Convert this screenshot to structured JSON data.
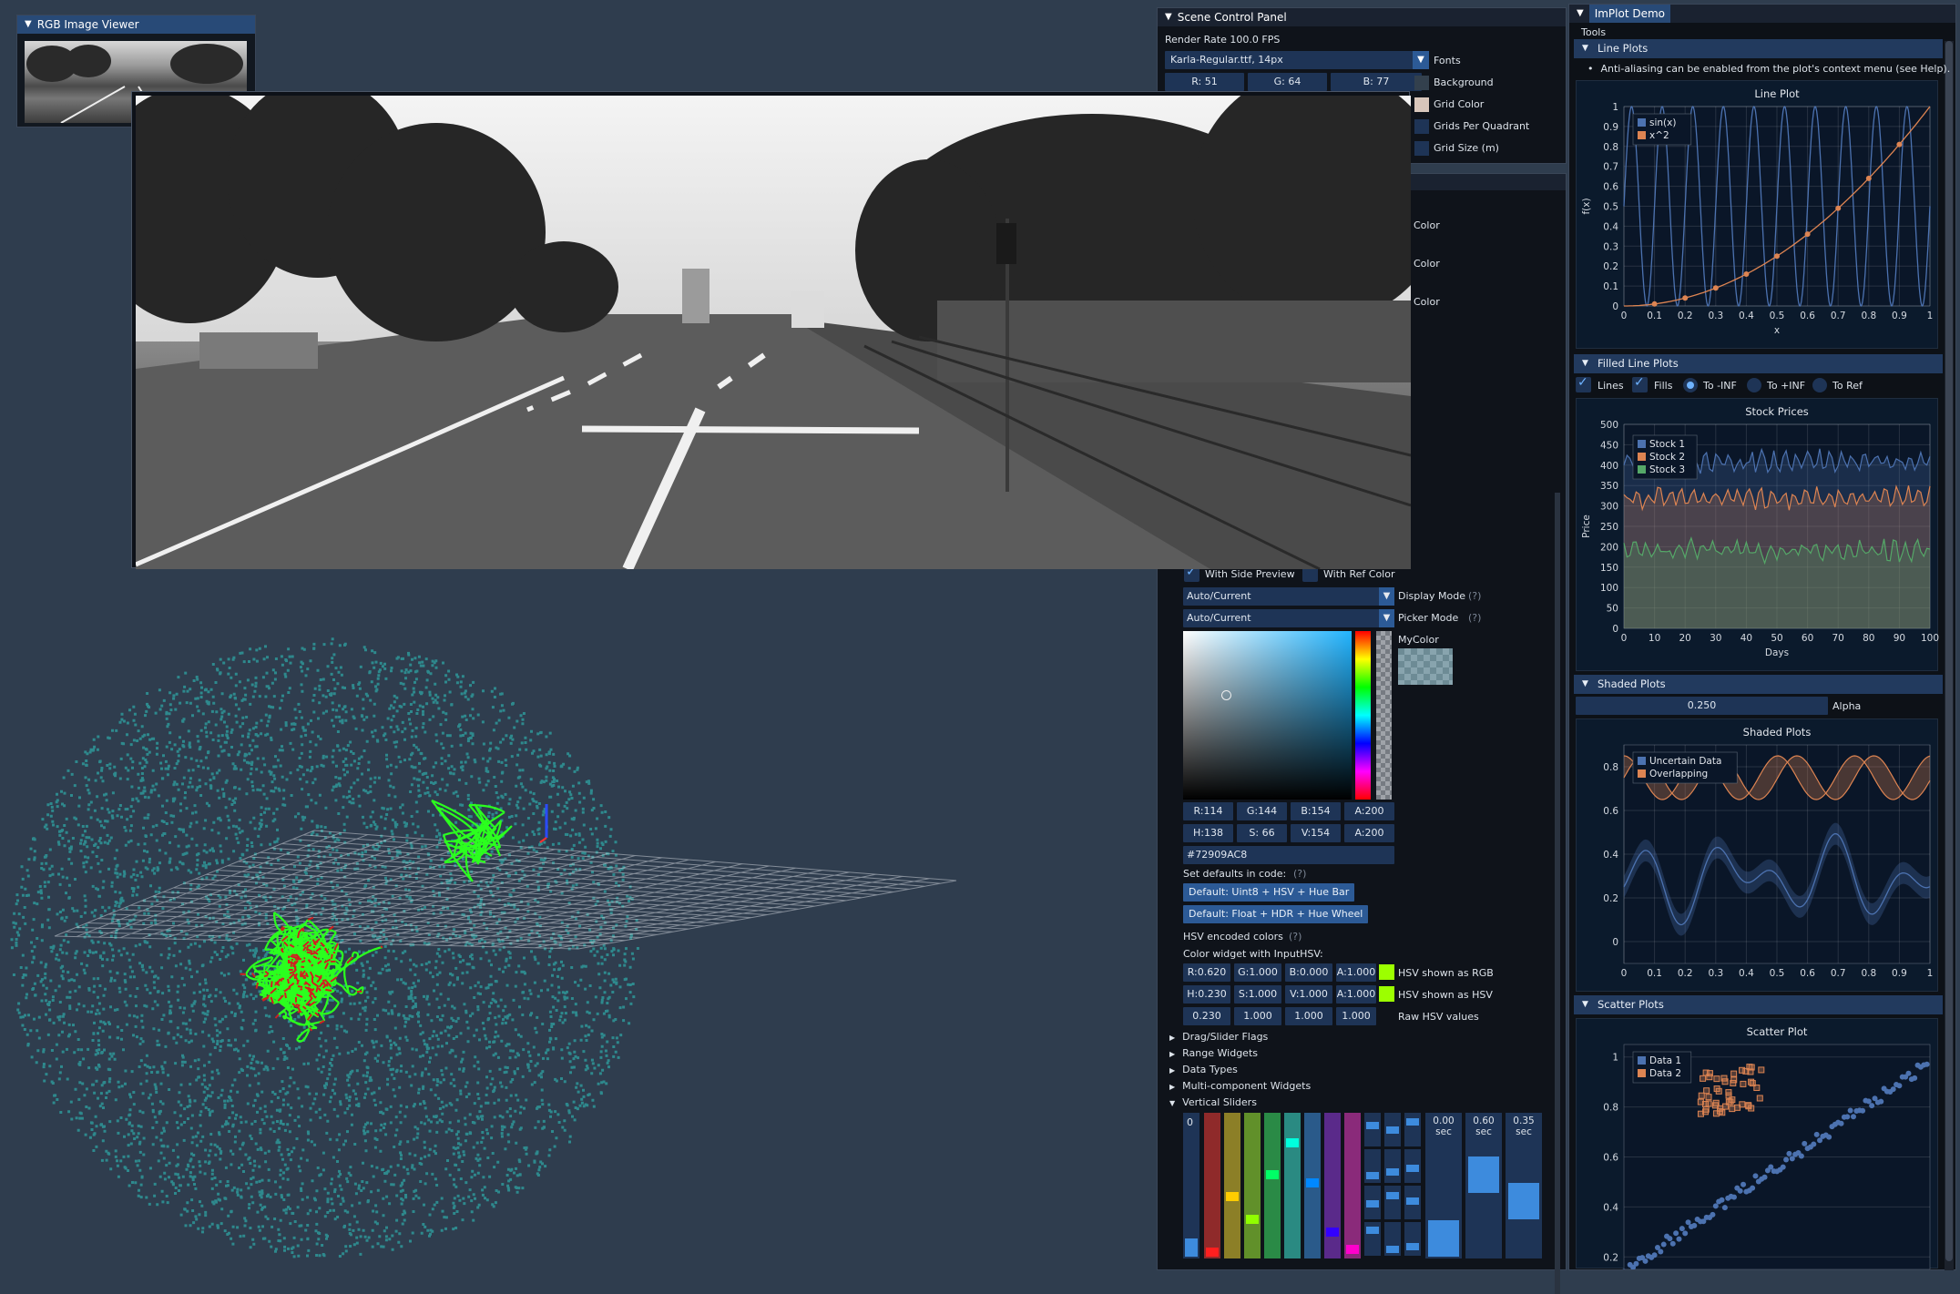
{
  "rgb_viewer": {
    "title": "RGB Image Viewer"
  },
  "scene_panel": {
    "title": "Scene Control Panel",
    "render_rate": "Render Rate 100.0 FPS",
    "font_select": "Karla-Regular.ttf, 14px",
    "fonts_label": "Fonts",
    "bg": {
      "r": "R: 51",
      "g": "G: 64",
      "b": "B: 77"
    },
    "background_label": "Background",
    "grid_color_label": "Grid Color",
    "grids_per_quadrant_label": "Grids Per Quadrant",
    "grid_size_label": "Grid Size (m)",
    "color_labels": [
      "Color",
      "Color",
      "Color"
    ]
  },
  "color_widgets": {
    "side_preview": "With Side Preview",
    "ref_color": "With Ref Color",
    "display_mode_value": "Auto/Current",
    "display_mode_label": "Display Mode",
    "picker_mode_value": "Auto/Current",
    "picker_mode_label": "Picker Mode",
    "help": "(?)",
    "mycolor_label": "MyColor",
    "rgba": {
      "r": "R:114",
      "g": "G:144",
      "b": "B:154",
      "a": "A:200"
    },
    "hsva": {
      "h": "H:138",
      "s": "S: 66",
      "v": "V:154",
      "a": "A:200"
    },
    "hex": "#72909AC8",
    "defaults_label": "Set defaults in code:",
    "default1": "Default: Uint8 + HSV + Hue Bar",
    "default2": "Default: Float + HDR + Hue Wheel",
    "hsv_encoded": "HSV encoded colors",
    "inputhsv": "Color widget with InputHSV:",
    "row1": {
      "a": "R:0.620",
      "b": "G:1.000",
      "c": "B:0.000",
      "d": "A:1.000",
      "label": "HSV shown as RGB"
    },
    "row2": {
      "a": "H:0.230",
      "b": "S:1.000",
      "c": "V:1.000",
      "d": "A:1.000",
      "label": "HSV shown as HSV"
    },
    "row3": {
      "a": "0.230",
      "b": "1.000",
      "c": "1.000",
      "d": "1.000",
      "label": "Raw HSV values"
    },
    "tree": [
      "Drag/Slider Flags",
      "Range Widgets",
      "Data Types",
      "Multi-component Widgets",
      "Vertical Sliders"
    ],
    "vslider_first": "0",
    "sec_sliders": [
      {
        "v": "0.00",
        "u": "sec",
        "level": 0.0
      },
      {
        "v": "0.60",
        "u": "sec",
        "level": 0.6
      },
      {
        "v": "0.35",
        "u": "sec",
        "level": 0.35
      }
    ]
  },
  "implot": {
    "title": "ImPlot Demo",
    "tools": "Tools",
    "line_plots_header": "Line Plots",
    "aa_note": "Anti-aliasing can be enabled from the plot's context menu (see Help).",
    "filled_header": "Filled Line Plots",
    "filled_opts": {
      "lines": "Lines",
      "fills": "Fills",
      "neg": "To -INF",
      "pos": "To +INF",
      "ref": "To Ref"
    },
    "shaded_header": "Shaded Plots",
    "alpha_value": "0.250",
    "alpha_label": "Alpha",
    "scatter_header": "Scatter Plots"
  },
  "chart_data": [
    {
      "type": "line",
      "title": "Line Plot",
      "xlabel": "x",
      "ylabel": "f(x)",
      "xlim": [
        0,
        1
      ],
      "ylim": [
        0,
        1
      ],
      "xticks": [
        "0",
        "0.1",
        "0.2",
        "0.3",
        "0.4",
        "0.5",
        "0.6",
        "0.7",
        "0.8",
        "0.9",
        "1"
      ],
      "yticks": [
        "0",
        "0.1",
        "0.2",
        "0.3",
        "0.4",
        "0.5",
        "0.6",
        "0.7",
        "0.8",
        "0.9",
        "1"
      ],
      "series": [
        {
          "name": "sin(x)",
          "color": "#4c72b0",
          "note_freq_cycles": 10
        },
        {
          "name": "x^2",
          "color": "#dd8452",
          "x": [
            0.1,
            0.2,
            0.3,
            0.4,
            0.5,
            0.6,
            0.7,
            0.8,
            0.9
          ],
          "values": [
            0.01,
            0.04,
            0.09,
            0.16,
            0.25,
            0.36,
            0.49,
            0.64,
            0.81
          ]
        }
      ],
      "legend": "top-left"
    },
    {
      "type": "area",
      "title": "Stock Prices",
      "xlabel": "Days",
      "ylabel": "Price",
      "xlim": [
        0,
        100
      ],
      "ylim": [
        0,
        500
      ],
      "xticks": [
        "0",
        "10",
        "20",
        "30",
        "40",
        "50",
        "60",
        "70",
        "80",
        "90",
        "100"
      ],
      "yticks": [
        "0",
        "50",
        "100",
        "150",
        "200",
        "250",
        "300",
        "350",
        "400",
        "450",
        "500"
      ],
      "series": [
        {
          "name": "Stock 1",
          "color": "#4c72b0",
          "mean": 410
        },
        {
          "name": "Stock 2",
          "color": "#dd8452",
          "mean": 320
        },
        {
          "name": "Stock 3",
          "color": "#55a868",
          "mean": 190
        }
      ],
      "legend": "top-left"
    },
    {
      "type": "area",
      "title": "Shaded Plots",
      "xlim": [
        0,
        1
      ],
      "ylim": [
        -0.1,
        0.9
      ],
      "xticks": [
        "0",
        "0.1",
        "0.2",
        "0.3",
        "0.4",
        "0.5",
        "0.6",
        "0.7",
        "0.8",
        "0.9",
        "1"
      ],
      "yticks": [
        "0",
        "0.2",
        "0.4",
        "0.6",
        "0.8"
      ],
      "series": [
        {
          "name": "Uncertain Data",
          "color": "#4c72b0"
        },
        {
          "name": "Overlapping",
          "color": "#dd8452"
        }
      ],
      "legend": "top-left"
    },
    {
      "type": "scatter",
      "title": "Scatter Plot",
      "xlim": [
        0,
        1
      ],
      "ylim": [
        0.15,
        1.05
      ],
      "yticks": [
        "0.2",
        "0.4",
        "0.6",
        "0.8",
        "1"
      ],
      "series": [
        {
          "name": "Data 1",
          "color": "#4c72b0"
        },
        {
          "name": "Data 2",
          "color": "#dd8452"
        }
      ],
      "legend": "top-left"
    }
  ]
}
